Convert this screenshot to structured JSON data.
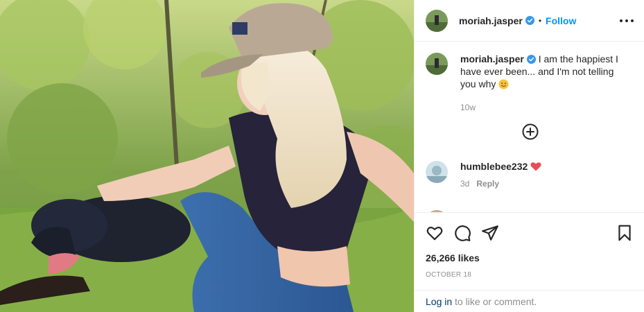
{
  "post": {
    "username": "moriah.jasper",
    "follow_label": "Follow",
    "separator": "•",
    "caption_text": " I am the happiest I have ever been... and I'm not telling you why ",
    "caption_time": "10w",
    "likes": "26,266 likes",
    "date": "OCTOBER 18"
  },
  "comments": [
    {
      "username": "humblebee232",
      "time": "3d",
      "reply_label": "Reply"
    }
  ],
  "login": {
    "link": "Log in",
    "text": " to like or comment."
  },
  "icons": {
    "more": "more-options-icon",
    "verified": "verified-badge-icon",
    "add_comment": "add-circle-icon",
    "like": "heart-icon",
    "comment": "comment-icon",
    "share": "share-icon",
    "save": "bookmark-icon",
    "emoji": "smiling-face-emoji-icon",
    "red_heart": "red-heart-emoji-icon"
  },
  "colors": {
    "link_blue": "#0095f6",
    "verified_blue": "#3897f0",
    "muted": "#8e8e8e",
    "red_heart": "#ed4956"
  }
}
